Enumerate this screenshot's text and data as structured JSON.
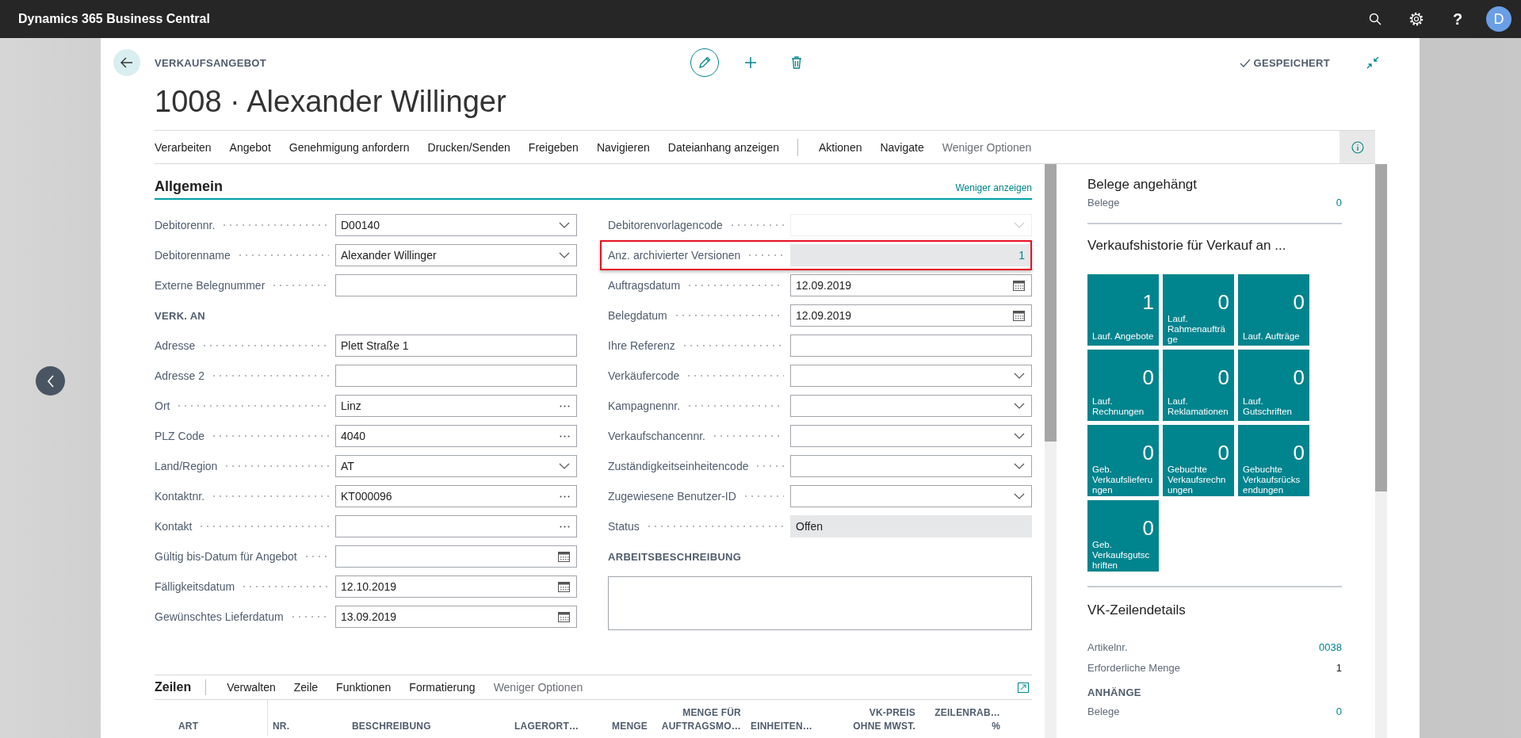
{
  "app": {
    "title": "Dynamics 365 Business Central",
    "help": "?",
    "avatar": "D"
  },
  "page": {
    "caption": "VERKAUFSANGEBOT",
    "title": "1008 · Alexander Willinger",
    "status": "GESPEICHERT"
  },
  "action_bar": {
    "actions": [
      "Verarbeiten",
      "Angebot",
      "Genehmigung anfordern",
      "Drucken/Senden",
      "Freigeben",
      "Navigieren",
      "Dateianhang anzeigen"
    ],
    "more_actions": [
      "Aktionen",
      "Navigate"
    ],
    "toggle": "Weniger Optionen"
  },
  "general": {
    "title": "Allgemein",
    "toggle": "Weniger anzeigen",
    "left": [
      {
        "kind": "dropdown",
        "label": "Debitorennr.",
        "value": "D00140",
        "disabled": false,
        "highlighted": false
      },
      {
        "kind": "dropdown",
        "label": "Debitorenname",
        "value": "Alexander Willinger",
        "disabled": false,
        "highlighted": false
      },
      {
        "kind": "text",
        "label": "Externe Belegnummer",
        "disabled": false,
        "highlighted": false
      },
      {
        "kind": "heading",
        "label": "VERK. AN"
      },
      {
        "kind": "text",
        "label": "Adresse",
        "value": "Plett Straße 1",
        "disabled": false,
        "highlighted": false
      },
      {
        "kind": "text",
        "label": "Adresse 2",
        "disabled": false,
        "highlighted": false
      },
      {
        "kind": "lookup",
        "label": "Ort",
        "value": "Linz",
        "disabled": false,
        "highlighted": false
      },
      {
        "kind": "lookup",
        "label": "PLZ Code",
        "value": "4040",
        "disabled": false,
        "highlighted": false
      },
      {
        "kind": "dropdown",
        "label": "Land/Region",
        "value": "AT",
        "disabled": false,
        "highlighted": false
      },
      {
        "kind": "lookup",
        "label": "Kontaktnr.",
        "value": "KT000096",
        "disabled": false,
        "highlighted": false
      },
      {
        "kind": "lookup",
        "label": "Kontakt",
        "disabled": false,
        "highlighted": false
      },
      {
        "kind": "date",
        "label": "Gültig bis-Datum für Angebot",
        "disabled": false,
        "highlighted": false
      },
      {
        "kind": "date",
        "label": "Fälligkeitsdatum",
        "value": "12.10.2019",
        "disabled": false,
        "highlighted": false
      },
      {
        "kind": "date",
        "label": "Gewünschtes Lieferdatum",
        "value": "13.09.2019",
        "disabled": false,
        "highlighted": false
      }
    ],
    "right": [
      {
        "kind": "dropdown",
        "label": "Debitorenvorlagencode",
        "disabled": true,
        "highlighted": false
      },
      {
        "kind": "drilldown",
        "label": "Anz. archivierter Versionen",
        "value": "1",
        "disabled": false,
        "highlighted": true
      },
      {
        "kind": "date",
        "label": "Auftragsdatum",
        "value": "12.09.2019",
        "disabled": false,
        "highlighted": false
      },
      {
        "kind": "date",
        "label": "Belegdatum",
        "value": "12.09.2019",
        "disabled": false,
        "highlighted": false
      },
      {
        "kind": "text",
        "label": "Ihre Referenz",
        "disabled": false,
        "highlighted": false
      },
      {
        "kind": "dropdown",
        "label": "Verkäufercode",
        "disabled": false,
        "highlighted": false
      },
      {
        "kind": "dropdown",
        "label": "Kampagnennr.",
        "disabled": false,
        "highlighted": false
      },
      {
        "kind": "dropdown",
        "label": "Verkaufschancennr.",
        "disabled": false,
        "highlighted": false
      },
      {
        "kind": "dropdown",
        "label": "Zuständigkeitseinheitencode",
        "disabled": false,
        "highlighted": false
      },
      {
        "kind": "dropdown",
        "label": "Zugewiesene Benutzer-ID",
        "disabled": false,
        "highlighted": false
      },
      {
        "kind": "readonly",
        "label": "Status",
        "value": "Offen",
        "disabled": false,
        "highlighted": false
      },
      {
        "kind": "heading",
        "label": "ARBEITSBESCHREIBUNG"
      },
      {
        "kind": "textarea"
      }
    ]
  },
  "lines": {
    "title": "Zeilen",
    "actions": [
      "Verwalten",
      "Zeile",
      "Funktionen",
      "Formatierung"
    ],
    "toggle": "Weniger Optionen",
    "columns": [
      {
        "kind": "text",
        "label": "ART"
      },
      {
        "kind": "text",
        "label": "NR."
      },
      {
        "kind": "text",
        "label": "BESCHREIBUNG"
      },
      {
        "kind": "text",
        "label": "LAGERORT…"
      },
      {
        "kind": "number",
        "label": "MENGE"
      },
      {
        "kind": "number",
        "label": "MENGE FÜR\nAUFTRAGSMO…"
      },
      {
        "kind": "text",
        "label": "EINHEITEN…"
      },
      {
        "kind": "number",
        "label": "VK-PREIS\nOHNE MWST."
      },
      {
        "kind": "number",
        "label": "ZEILENRAB…\n%"
      }
    ]
  },
  "factbox": {
    "attachments": {
      "title": "Belege angehängt",
      "rows": [
        {
          "label": "Belege",
          "value": "0",
          "link": true
        }
      ]
    },
    "history": {
      "title": "Verkaufshistorie für Verkauf an ...",
      "tiles": [
        {
          "value": "1",
          "label": "Lauf. Angebote"
        },
        {
          "value": "0",
          "label": "Lauf. Rahmenaufträge"
        },
        {
          "value": "0",
          "label": "Lauf. Aufträge"
        },
        {
          "value": "0",
          "label": "Lauf. Rechnungen"
        },
        {
          "value": "0",
          "label": "Lauf. Reklamationen"
        },
        {
          "value": "0",
          "label": "Lauf. Gutschriften"
        },
        {
          "value": "0",
          "label": "Geb. Verkaufslieferungen"
        },
        {
          "value": "0",
          "label": "Gebuchte Verkaufsrechnungen"
        },
        {
          "value": "0",
          "label": "Gebuchte Verkaufsrücksendungen"
        },
        {
          "value": "0",
          "label": "Geb. Verkaufsgutschriften"
        }
      ]
    },
    "line_details": {
      "title": "VK-Zeilendetails",
      "rows": [
        {
          "label": "Artikelnr.",
          "value": "0038",
          "link": true
        },
        {
          "label": "Erforderliche Menge",
          "value": "1",
          "link": false
        }
      ],
      "subheading": "ANHÄNGE",
      "sub_rows": [
        {
          "label": "Belege",
          "value": "0",
          "link": true
        }
      ]
    }
  }
}
